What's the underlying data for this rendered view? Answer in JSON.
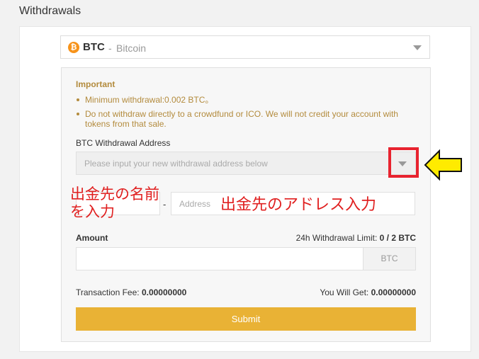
{
  "page": {
    "title": "Withdrawals"
  },
  "coin_select": {
    "icon_glyph": "₿",
    "symbol": "BTC",
    "separator": "-",
    "name": "Bitcoin",
    "icon_color": "#f7931a"
  },
  "notice": {
    "title": "Important",
    "items": [
      "Minimum withdrawal:0.002 BTC。",
      "Do not withdraw directly to a crowdfund or ICO. We will not credit your account with tokens from that sale."
    ],
    "color": "#b38b3d"
  },
  "address": {
    "label": "BTC Withdrawal Address",
    "select_placeholder": "Please input your new withdrawal address below",
    "address_placeholder": "Address",
    "separator": "-"
  },
  "annotations": {
    "name_note": "出金先の名前を入力",
    "address_note": "出金先のアドレス入力",
    "highlight_color": "#e8232f",
    "arrow_color": "#ffeb00"
  },
  "amount": {
    "label": "Amount",
    "limit_label": "24h Withdrawal Limit:",
    "limit_value": "0 / 2 BTC",
    "unit": "BTC"
  },
  "summary": {
    "fee_label": "Transaction Fee:",
    "fee_value": "0.00000000",
    "get_label": "You Will Get:",
    "get_value": "0.00000000"
  },
  "actions": {
    "submit_label": "Submit",
    "submit_color": "#e9b235"
  }
}
